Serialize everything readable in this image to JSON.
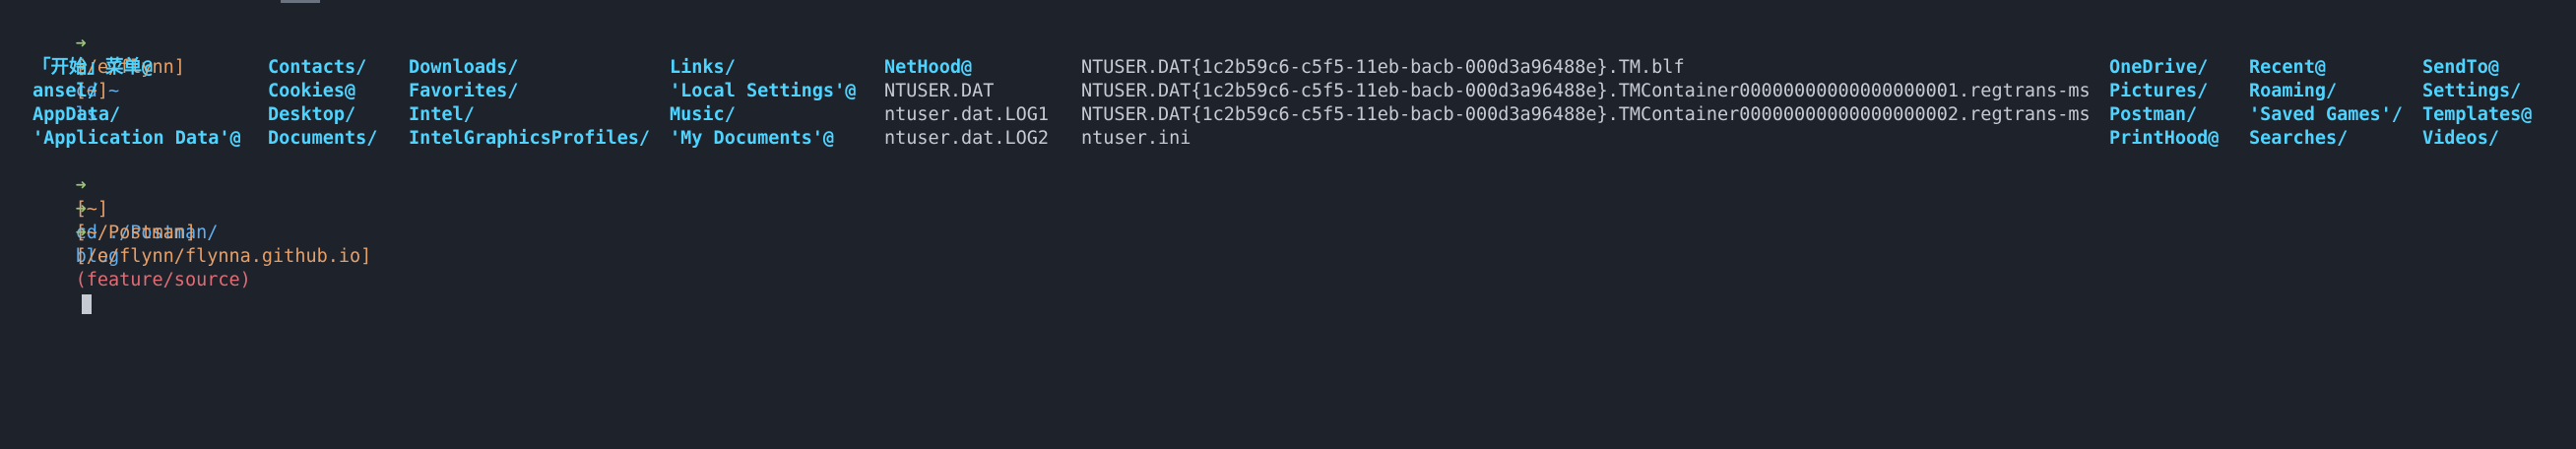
{
  "prompt_lines": [
    {
      "arrow": "➜",
      "path": "[/e/flynn]",
      "command": "cd ~",
      "branch": ""
    },
    {
      "arrow": "➜",
      "path": "[~]",
      "command": "ls",
      "branch": ""
    },
    {
      "arrow": "➜",
      "path": "[~]",
      "command": "cd ./Postman/",
      "branch": ""
    },
    {
      "arrow": "➜",
      "path": "[~/Postman]",
      "command": "blog",
      "branch": ""
    },
    {
      "arrow": "➜",
      "path": "[/e/flynn/flynna.github.io]",
      "command": "",
      "branch": "(feature/source)"
    }
  ],
  "ls_output": {
    "rows": [
      [
        {
          "text": "「开始」菜单@",
          "kind": "dir"
        },
        {
          "text": "Contacts/",
          "kind": "dir"
        },
        {
          "text": "Downloads/",
          "kind": "dir"
        },
        {
          "text": "Links/",
          "kind": "dir"
        },
        {
          "text": "NetHood@",
          "kind": "dir"
        },
        {
          "text": "NTUSER.DAT{1c2b59c6-c5f5-11eb-bacb-000d3a96488e}.TM.blf",
          "kind": "file"
        },
        {
          "text": "OneDrive/",
          "kind": "dir"
        },
        {
          "text": "Recent@",
          "kind": "dir"
        },
        {
          "text": "SendTo@",
          "kind": "dir"
        }
      ],
      [
        {
          "text": "ansel/",
          "kind": "dir"
        },
        {
          "text": "Cookies@",
          "kind": "dir"
        },
        {
          "text": "Favorites/",
          "kind": "dir"
        },
        {
          "text": "'Local Settings'@",
          "kind": "dir"
        },
        {
          "text": "NTUSER.DAT",
          "kind": "file"
        },
        {
          "text": "NTUSER.DAT{1c2b59c6-c5f5-11eb-bacb-000d3a96488e}.TMContainer00000000000000000001.regtrans-ms",
          "kind": "file"
        },
        {
          "text": "Pictures/",
          "kind": "dir"
        },
        {
          "text": "Roaming/",
          "kind": "dir"
        },
        {
          "text": "Settings/",
          "kind": "dir"
        }
      ],
      [
        {
          "text": "AppData/",
          "kind": "dir"
        },
        {
          "text": "Desktop/",
          "kind": "dir"
        },
        {
          "text": "Intel/",
          "kind": "dir"
        },
        {
          "text": "Music/",
          "kind": "dir"
        },
        {
          "text": "ntuser.dat.LOG1",
          "kind": "file"
        },
        {
          "text": "NTUSER.DAT{1c2b59c6-c5f5-11eb-bacb-000d3a96488e}.TMContainer00000000000000000002.regtrans-ms",
          "kind": "file"
        },
        {
          "text": "Postman/",
          "kind": "dir"
        },
        {
          "text": "'Saved Games'/",
          "kind": "dir"
        },
        {
          "text": "Templates@",
          "kind": "dir"
        }
      ],
      [
        {
          "text": "'Application Data'@",
          "kind": "dir"
        },
        {
          "text": "Documents/",
          "kind": "dir"
        },
        {
          "text": "IntelGraphicsProfiles/",
          "kind": "dir"
        },
        {
          "text": "'My Documents'@",
          "kind": "dir"
        },
        {
          "text": "ntuser.dat.LOG2",
          "kind": "file"
        },
        {
          "text": "ntuser.ini",
          "kind": "file"
        },
        {
          "text": "PrintHood@",
          "kind": "dir"
        },
        {
          "text": "Searches/",
          "kind": "dir"
        },
        {
          "text": "Videos/",
          "kind": "dir"
        }
      ]
    ]
  },
  "colors": {
    "background": "#1e222a",
    "arrow": "#98c379",
    "path": "#e5a06a",
    "command": "#61afef",
    "branch": "#e06c75",
    "directory": "#4fd3ff",
    "file": "#c5cad3"
  }
}
